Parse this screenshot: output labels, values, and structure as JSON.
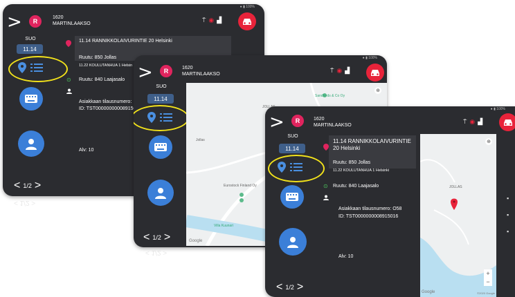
{
  "devices": [
    {
      "header": {
        "avatar_letter": "R",
        "line1": "1620",
        "line2": "MARTINLAAKSO"
      },
      "sidebar": {
        "direction": "SUO",
        "time": "11.14"
      },
      "content": {
        "address": "11.14 RANNIKKOLAIVURINTIE 20 Helsinki",
        "route1": "Ruutu: 850 Jollas",
        "sub1": "11.22 KOULUTANHUA 1 Helsin",
        "route2": "Ruutu: 840 Laajasalo",
        "order_label": "Asiakkaan tilausnumero:",
        "order_id": "ID: TST000000000089150",
        "alv": "Alv: 10"
      },
      "pager": {
        "text": "1/2"
      }
    },
    {
      "header": {
        "avatar_letter": "R",
        "line1": "1620",
        "line2": "MARTINLAAKSO"
      },
      "sidebar": {
        "direction": "SUO",
        "time": "11.14"
      },
      "pager": {
        "text": "1/2"
      },
      "map": {
        "labels": [
          "JOLLAS",
          "Sandfords & Co Oy",
          "Jollas",
          "Eurostock Finland Oy",
          "Villa Kuunari",
          "Google"
        ]
      }
    },
    {
      "header": {
        "avatar_letter": "R",
        "line1": "1620",
        "line2": "MARTINLAAKSO"
      },
      "sidebar": {
        "direction": "SUO",
        "time": "11.14"
      },
      "content": {
        "address": "11.14 RANNIKKOLAIVURINTIE 20 Helsinki",
        "route1": "Ruutu: 850 Jollas",
        "sub1": "11.22 KOULUTANHUA 1 Helsinki",
        "route2": "Ruutu: 840 Laajasalo",
        "order_label": "Asiakkaan tilausnumero: O58",
        "order_id": "ID: TST0000000008915016",
        "alv": "Alv: 10"
      },
      "pager": {
        "text": "1/2"
      },
      "map": {
        "labels": [
          "JOLLAS",
          "Google",
          "©2020 Google"
        ]
      }
    }
  ],
  "reflection": {
    "text": "< 1/2 >"
  },
  "colors": {
    "panel": "#2b2c30",
    "accent_blue": "#3b7fd8",
    "highlight_yellow": "#f2e21b",
    "brand_red": "#e8233a",
    "avatar_pink": "#e0245e"
  }
}
